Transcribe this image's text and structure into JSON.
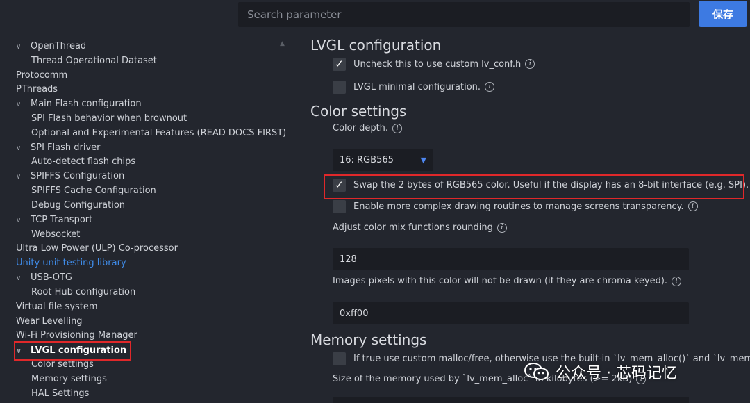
{
  "header": {
    "search_placeholder": "Search parameter",
    "save_label": "保存"
  },
  "sidebar": {
    "items": [
      {
        "label": "OpenThread",
        "chevron": true
      },
      {
        "label": "Thread Operational Dataset"
      },
      {
        "label": "Protocomm"
      },
      {
        "label": "PThreads"
      },
      {
        "label": "Main Flash configuration",
        "chevron": true
      },
      {
        "label": "SPI Flash behavior when brownout"
      },
      {
        "label": "Optional and Experimental Features (READ DOCS FIRST)"
      },
      {
        "label": "SPI Flash driver",
        "chevron": true
      },
      {
        "label": "Auto-detect flash chips"
      },
      {
        "label": "SPIFFS Configuration",
        "chevron": true
      },
      {
        "label": "SPIFFS Cache Configuration"
      },
      {
        "label": "Debug Configuration"
      },
      {
        "label": "TCP Transport",
        "chevron": true
      },
      {
        "label": "Websocket"
      },
      {
        "label": "Ultra Low Power (ULP) Co-processor"
      },
      {
        "label": "Unity unit testing library",
        "link": true
      },
      {
        "label": "USB-OTG",
        "chevron": true
      },
      {
        "label": "Root Hub configuration"
      },
      {
        "label": "Virtual file system"
      },
      {
        "label": "Wear Levelling"
      },
      {
        "label": "Wi-Fi Provisioning Manager"
      },
      {
        "label": "LVGL configuration",
        "chevron": true,
        "active": true
      },
      {
        "label": "Color settings"
      },
      {
        "label": "Memory settings"
      },
      {
        "label": "HAL Settings"
      }
    ]
  },
  "content": {
    "lvgl": {
      "title": "LVGL configuration",
      "custom_conf_label": "Uncheck this to use custom lv_conf.h",
      "custom_conf_checked": true,
      "minimal_label": "LVGL minimal configuration.",
      "minimal_checked": false
    },
    "color": {
      "title": "Color settings",
      "depth_label": "Color depth.",
      "depth_value": "16: RGB565",
      "swap_label": "Swap the 2 bytes of RGB565 color. Useful if the display has an 8-bit interface (e.g. SPI).",
      "swap_checked": true,
      "complex_label": "Enable more complex drawing routines to manage screens transparency.",
      "complex_checked": false,
      "mix_label": "Adjust color mix functions rounding",
      "mix_value": "128",
      "chroma_label": "Images pixels with this color will not be drawn (if they are chroma keyed).",
      "chroma_value": "0xff00"
    },
    "memory": {
      "title": "Memory settings",
      "custom_malloc_label": "If true use custom malloc/free, otherwise use the built-in `lv_mem_alloc()` and `lv_mem_free()`",
      "custom_malloc_checked": false,
      "size_label": "Size of the memory used by `lv_mem_alloc` in kilobytes (>= 2kB)"
    }
  },
  "icons": {
    "info": "info-icon",
    "chevron": "chevron-down-icon",
    "check": "check-icon"
  },
  "watermark": {
    "text": "公众号 · 芯码记忆"
  },
  "colors": {
    "background": "#23262e",
    "input_bg": "#1b1d23",
    "accent": "#3d7ae2",
    "link": "#3f8be8",
    "highlight_box": "#e0282a"
  }
}
